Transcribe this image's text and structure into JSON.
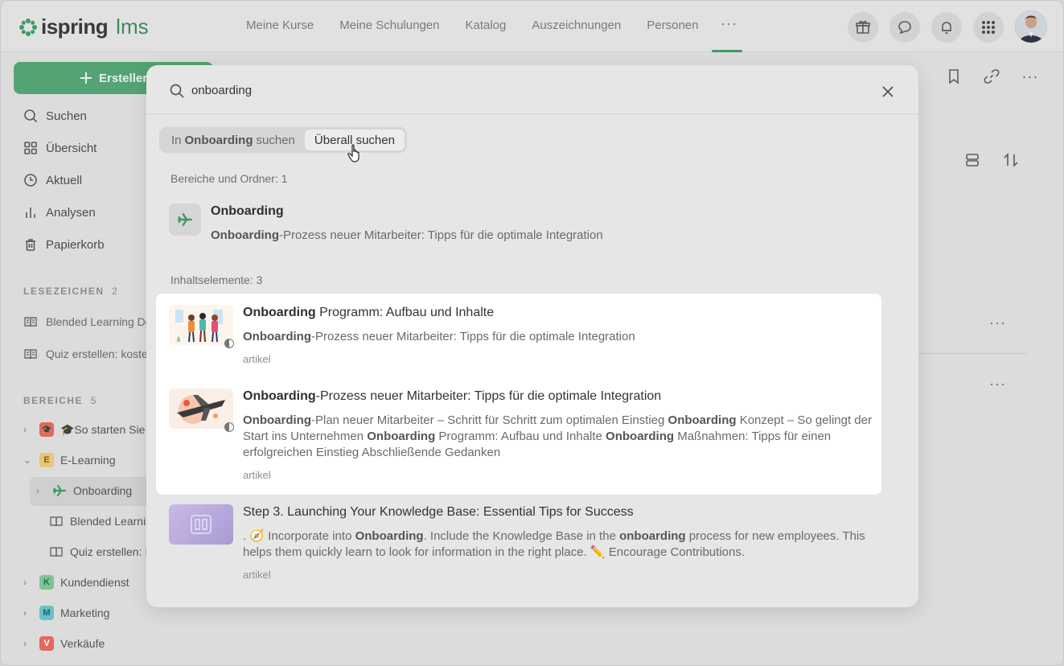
{
  "logo": {
    "brand": "ispring",
    "product": "lms"
  },
  "topnav": {
    "items": [
      "Meine Kurse",
      "Meine Schulungen",
      "Katalog",
      "Auszeichnungen",
      "Personen"
    ],
    "more": "···"
  },
  "sidebar": {
    "create_label": "Erstellen",
    "items": [
      "Suchen",
      "Übersicht",
      "Aktuell",
      "Analysen",
      "Papierkorb"
    ],
    "bookmarks_head": "LESEZEICHEN",
    "bookmarks_count": "2",
    "bookmarks": [
      "Blended Learning De",
      "Quiz erstellen: koste"
    ],
    "areas_head": "BEREICHE",
    "areas_count": "5",
    "areas": [
      {
        "letter": "🎓",
        "label": "🎓So starten Sie"
      },
      {
        "letter": "E",
        "label": "E-Learning"
      },
      {
        "label": "Onboarding"
      },
      {
        "label": "Blended Learni"
      },
      {
        "label": "Quiz erstellen: I"
      },
      {
        "letter": "K",
        "label": "Kundendienst"
      },
      {
        "letter": "M",
        "label": "Marketing"
      },
      {
        "letter": "V",
        "label": "Verkäufe"
      }
    ]
  },
  "colors": {
    "brand_green": "#3d9a64",
    "badge_e": "#e8c777",
    "badge_k": "#7cc495",
    "badge_m": "#66c2c9",
    "badge_v": "#e4685c",
    "badge_so": "#e06a5a"
  },
  "search": {
    "query": "onboarding",
    "scope_prefix": "In",
    "scope_name": "Onboarding",
    "scope_suffix": "suchen",
    "scope_everywhere": "Überall suchen",
    "folders_head": "Bereiche und Ordner: 1",
    "folder": {
      "title": "Onboarding",
      "desc_bold": "Onboarding",
      "desc_rest": "-Prozess neuer Mitarbeiter: Tipps für die optimale Integration"
    },
    "items_head": "Inhaltselemente: 3",
    "results": [
      {
        "title_bold": "Onboarding",
        "title_rest": " Programm: Aufbau und Inhalte",
        "desc_bold": "Onboarding",
        "desc_rest": "-Prozess neuer Mitarbeiter: Tipps für die optimale Integration",
        "type": "artikel"
      },
      {
        "title_bold": "Onboarding",
        "title_rest": "-Prozess neuer Mitarbeiter: Tipps für die optimale Integration",
        "desc": [
          {
            "b": "Onboarding"
          },
          {
            "t": "-Plan neuer Mitarbeiter – Schritt für Schritt zum optimalen Einstieg "
          },
          {
            "b": "Onboarding"
          },
          {
            "t": " Konzept – So gelingt der Start ins Unternehmen "
          },
          {
            "b": "Onboarding"
          },
          {
            "t": " Programm: Aufbau und Inhalte "
          },
          {
            "b": "Onboarding"
          },
          {
            "t": " Maßnahmen: Tipps für einen erfolgreichen Einstieg Abschließende Gedanken"
          }
        ],
        "type": "artikel"
      },
      {
        "title": "Step 3. Launching Your Knowledge Base: Essential Tips for Success",
        "desc": [
          {
            "t": ". 🧭 Incorporate into "
          },
          {
            "b": "Onboarding"
          },
          {
            "t": ". Include the Knowledge Base in the "
          },
          {
            "b": "onboarding"
          },
          {
            "t": " process for new employees. This helps them quickly learn to look for information in the right place. ✏️ Encourage Contributions."
          }
        ],
        "type": "artikel"
      }
    ]
  }
}
